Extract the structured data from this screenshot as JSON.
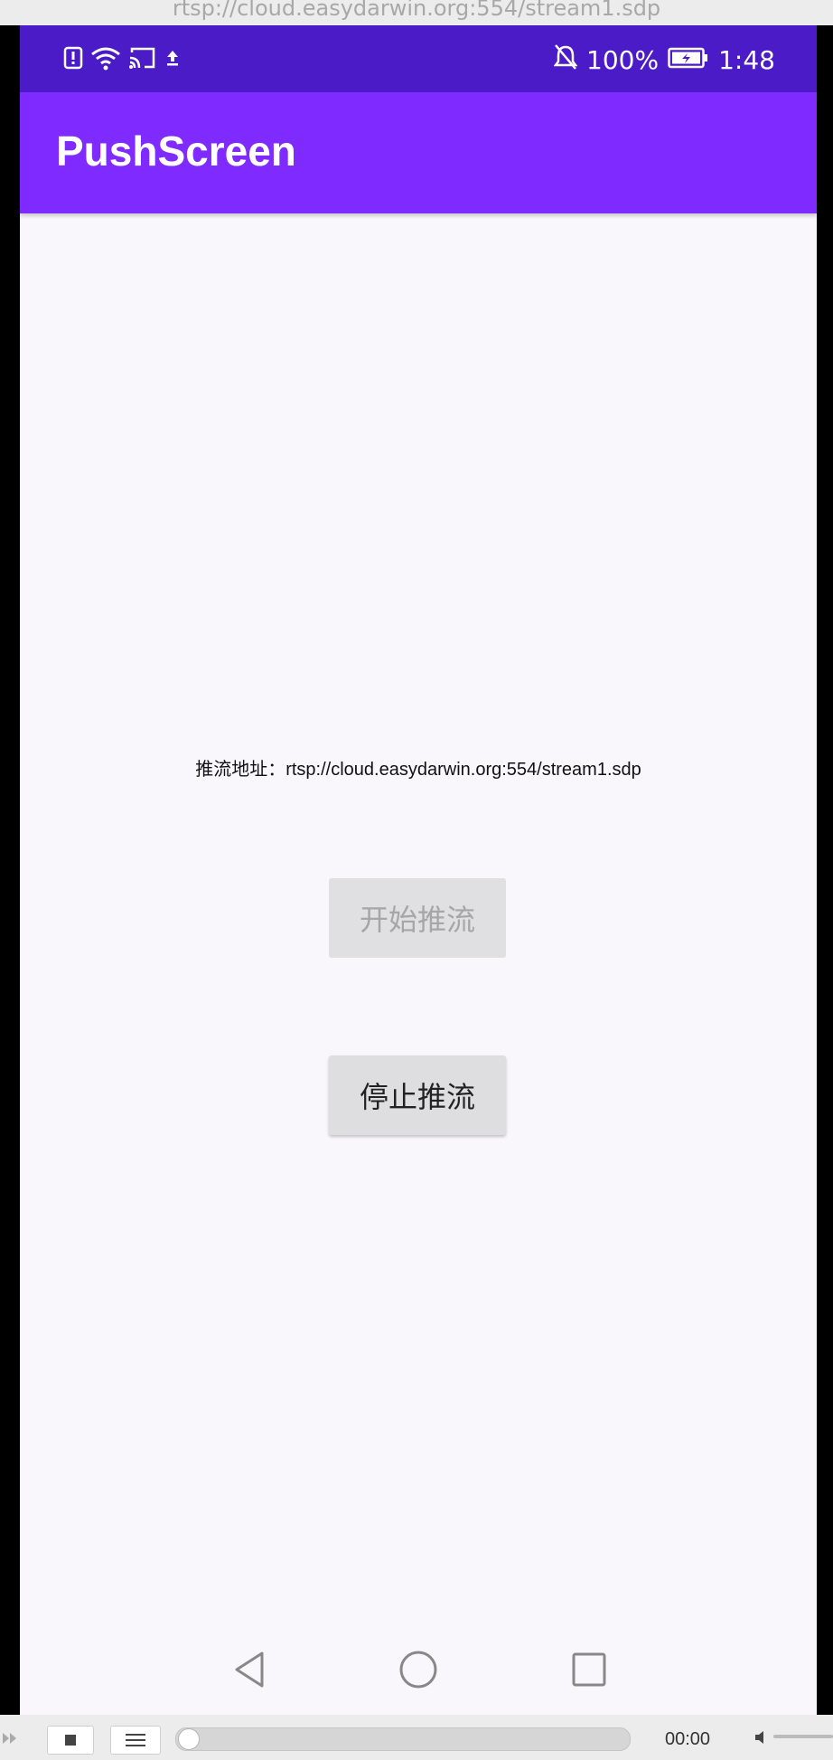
{
  "window": {
    "title": "rtsp://cloud.easydarwin.org:554/stream1.sdp"
  },
  "status_bar": {
    "battery": "100%",
    "time": "1:48",
    "icons_left": [
      "alert-icon",
      "wifi-icon",
      "cast-icon",
      "upload-icon"
    ],
    "icons_right": [
      "notifications-off-icon",
      "battery-charging-icon"
    ]
  },
  "app_bar": {
    "title": "PushScreen",
    "color": "#7f2bff"
  },
  "main": {
    "address_label": "推流地址：rtsp://cloud.easydarwin.org:554/stream1.sdp",
    "start_button": "开始推流",
    "stop_button": "停止推流"
  },
  "nav_bar": {
    "icons": [
      "back-icon",
      "home-icon",
      "recents-icon"
    ]
  },
  "player": {
    "time": "00:00",
    "progress": 0
  }
}
